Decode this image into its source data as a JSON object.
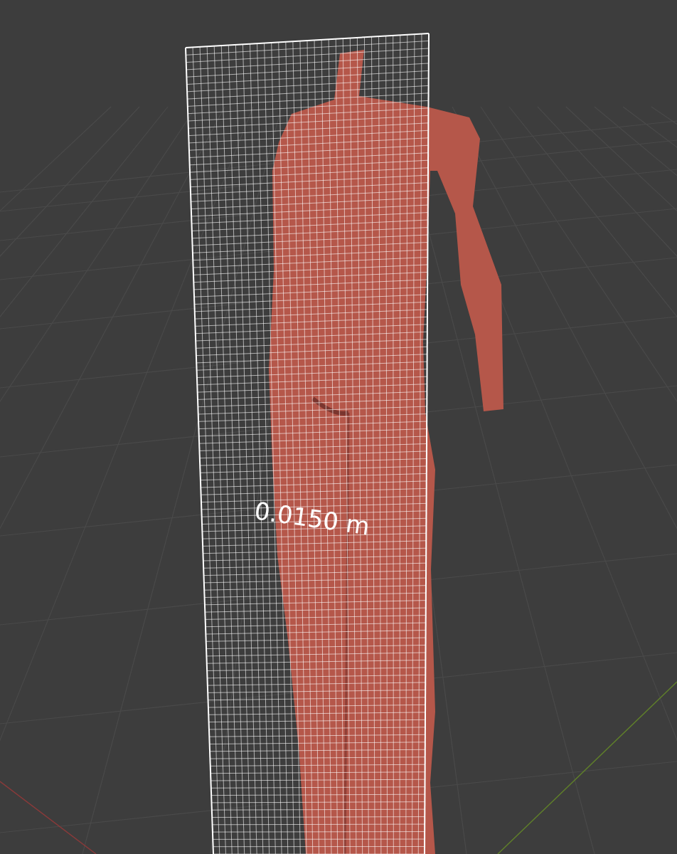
{
  "viewport": {
    "measurement": "0.0150 m"
  }
}
